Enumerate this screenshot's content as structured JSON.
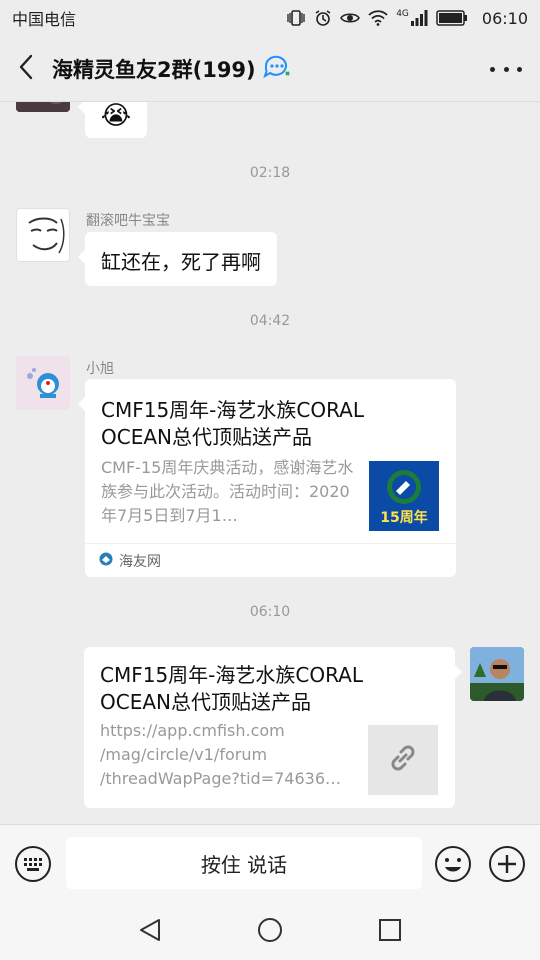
{
  "status_bar": {
    "carrier": "中国电信",
    "network": "4G",
    "time": "06:10"
  },
  "header": {
    "back_icon": "back-chevron-icon",
    "title": "海精灵鱼友2群(199)",
    "group_icon": "group-chat-icon",
    "more_icon": "more-dots-icon"
  },
  "messages": {
    "partial_top": {
      "emoji": "😭"
    },
    "time_1": "02:18",
    "msg_1": {
      "sender": "翻滚吧牛宝宝",
      "text": "缸还在，死了再啊"
    },
    "time_2": "04:42",
    "msg_2": {
      "sender": "小旭",
      "card_title": "CMF15周年-海艺水族CORAL OCEAN总代顶贴送产品",
      "card_desc": "CMF-15周年庆典活动，感谢海艺水族参与此次活动。活动时间：2020年7月5日到7月1…",
      "thumb_text": "15周年",
      "source": "海友网"
    },
    "time_3": "06:10",
    "msg_3": {
      "card_title": "CMF15周年-海艺水族CORAL OCEAN总代顶贴送产品",
      "url_line1": "https://app.cmfish.com",
      "url_line2": "/mag/circle/v1/forum",
      "url_line3": "/threadWapPage?tid=74636…",
      "link_icon": "link-icon"
    }
  },
  "input_bar": {
    "hold_to_talk": "按住 说话",
    "keyboard_icon": "keyboard-icon",
    "emoji_icon": "emoji-icon",
    "plus_icon": "plus-icon"
  },
  "nav_bar": {
    "back_icon": "nav-back-icon",
    "home_icon": "nav-home-icon",
    "recents_icon": "nav-recents-icon"
  },
  "colors": {
    "background": "#ededed",
    "bubble": "#ffffff",
    "muted_text": "#999999",
    "accent_blue": "#1e90ff"
  }
}
